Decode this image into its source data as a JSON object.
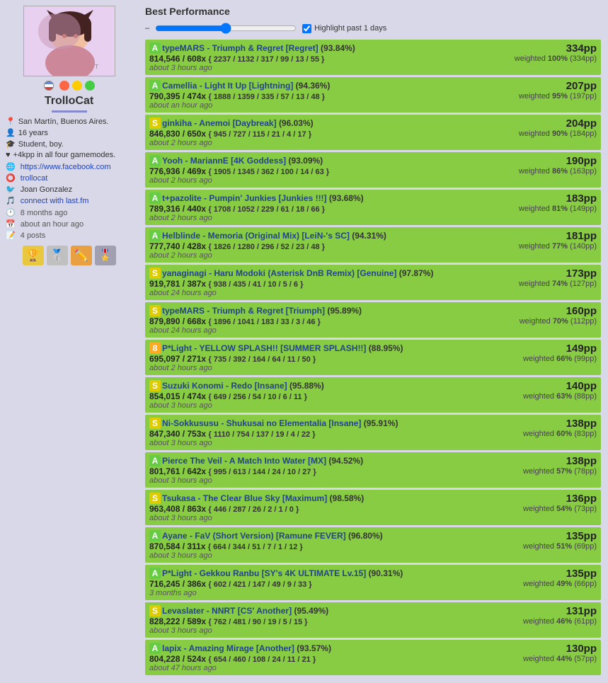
{
  "sidebar": {
    "username": "TrolloCat",
    "location": "San Martín, Buenos Aires.",
    "age": "16 years",
    "title": "Student, boy.",
    "tagline": "+4kpp in all four gamemodes.",
    "website": "https://www.facebook.com",
    "osu_name": "trollocat",
    "twitter": "Joan Gonzalez",
    "lastfm": "connect with last.fm",
    "last_online": "8 months ago",
    "member_since": "about an hour ago",
    "posts": "4 posts"
  },
  "main": {
    "title": "Best Performance",
    "highlight_label": "Highlight past 1 days",
    "performances": [
      {
        "rank": "A",
        "title": "typeMARS - Triumph & Regret [Regret]",
        "accuracy": "(93.84%)",
        "score": "814,546 / 608x",
        "hits": "{ 2237 / 1132 / 317 / 99 / 13 / 55 }",
        "time": "about 3 hours ago",
        "pp": "334pp",
        "weighted_pct": "100%",
        "weighted_pp": "334pp"
      },
      {
        "rank": "A",
        "title": "Camellia - Light It Up [Lightning]",
        "accuracy": "(94.36%)",
        "score": "790,395 / 474x",
        "hits": "{ 1888 / 1359 / 335 / 57 / 13 / 48 }",
        "time": "about an hour ago",
        "pp": "207pp",
        "weighted_pct": "95%",
        "weighted_pp": "197pp"
      },
      {
        "rank": "S",
        "title": "ginkiha - Anemoi [Daybreak]",
        "accuracy": "(96.03%)",
        "score": "846,830 / 650x",
        "hits": "{ 945 / 727 / 115 / 21 / 4 / 17 }",
        "time": "about 2 hours ago",
        "pp": "204pp",
        "weighted_pct": "90%",
        "weighted_pp": "184pp"
      },
      {
        "rank": "A",
        "title": "Yooh - MariannE [4K Goddess]",
        "accuracy": "(93.09%)",
        "score": "776,936 / 469x",
        "hits": "{ 1905 / 1345 / 362 / 100 / 14 / 63 }",
        "time": "about 2 hours ago",
        "pp": "190pp",
        "weighted_pct": "86%",
        "weighted_pp": "163pp"
      },
      {
        "rank": "A",
        "title": "t+pazolite - Pumpin' Junkies [Junkies !!!]",
        "accuracy": "(93.68%)",
        "score": "789,316 / 440x",
        "hits": "{ 1708 / 1052 / 229 / 61 / 18 / 66 }",
        "time": "about 2 hours ago",
        "pp": "183pp",
        "weighted_pct": "81%",
        "weighted_pp": "149pp"
      },
      {
        "rank": "A",
        "title": "Helblinde - Memoria (Original Mix) [LeiN-'s SC]",
        "accuracy": "(94.31%)",
        "score": "777,740 / 428x",
        "hits": "{ 1826 / 1280 / 296 / 52 / 23 / 48 }",
        "time": "about 2 hours ago",
        "pp": "181pp",
        "weighted_pct": "77%",
        "weighted_pp": "140pp"
      },
      {
        "rank": "S",
        "title": "yanaginagi - Haru Modoki (Asterisk DnB Remix) [Genuine]",
        "accuracy": "(97.87%)",
        "score": "919,781 / 387x",
        "hits": "{ 938 / 435 / 41 / 10 / 5 / 6 }",
        "time": "about 24 hours ago",
        "pp": "173pp",
        "weighted_pct": "74%",
        "weighted_pp": "127pp"
      },
      {
        "rank": "S",
        "title": "typeMARS - Triumph & Regret [Triumph]",
        "accuracy": "(95.89%)",
        "score": "879,890 / 668x",
        "hits": "{ 1896 / 1041 / 183 / 33 / 3 / 46 }",
        "time": "about 24 hours ago",
        "pp": "160pp",
        "weighted_pct": "70%",
        "weighted_pp": "112pp"
      },
      {
        "rank": "8",
        "title": "P*Light - YELLOW SPLASH!! [SUMMER SPLASH!!]",
        "accuracy": "(88.95%)",
        "score": "695,097 / 271x",
        "hits": "{ 735 / 392 / 164 / 64 / 11 / 50 }",
        "time": "about 2 hours ago",
        "pp": "149pp",
        "weighted_pct": "66%",
        "weighted_pp": "99pp"
      },
      {
        "rank": "S",
        "title": "Suzuki Konomi - Redo [Insane]",
        "accuracy": "(95.88%)",
        "score": "854,015 / 474x",
        "hits": "{ 649 / 256 / 54 / 10 / 6 / 11 }",
        "time": "about 3 hours ago",
        "pp": "140pp",
        "weighted_pct": "63%",
        "weighted_pp": "88pp"
      },
      {
        "rank": "S",
        "title": "Ni-Sokkususu - Shukusai no Elementalia [Insane]",
        "accuracy": "(95.91%)",
        "score": "847,340 / 753x",
        "hits": "{ 1110 / 754 / 137 / 19 / 4 / 22 }",
        "time": "about 3 hours ago",
        "pp": "138pp",
        "weighted_pct": "60%",
        "weighted_pp": "83pp"
      },
      {
        "rank": "A",
        "title": "Pierce The Veil - A Match Into Water [MX]",
        "accuracy": "(94.52%)",
        "score": "801,761 / 642x",
        "hits": "{ 995 / 613 / 144 / 24 / 10 / 27 }",
        "time": "about 3 hours ago",
        "pp": "138pp",
        "weighted_pct": "57%",
        "weighted_pp": "78pp"
      },
      {
        "rank": "S",
        "title": "Tsukasa - The Clear Blue Sky [Maximum]",
        "accuracy": "(98.58%)",
        "score": "963,408 / 863x",
        "hits": "{ 446 / 287 / 26 / 2 / 1 / 0 }",
        "time": "about 3 hours ago",
        "pp": "136pp",
        "weighted_pct": "54%",
        "weighted_pp": "73pp"
      },
      {
        "rank": "A",
        "title": "Ayane - FaV (Short Version) [Ramune FEVER]",
        "accuracy": "(96.80%)",
        "score": "870,584 / 311x",
        "hits": "{ 664 / 344 / 51 / 7 / 1 / 12 }",
        "time": "about 3 hours ago",
        "pp": "135pp",
        "weighted_pct": "51%",
        "weighted_pp": "69pp"
      },
      {
        "rank": "A",
        "title": "P*Light - Gekkou Ranbu [SY's 4K ULTIMATE Lv.15]",
        "accuracy": "(90.31%)",
        "score": "716,245 / 386x",
        "hits": "{ 602 / 421 / 147 / 49 / 9 / 33 }",
        "time": "3 months ago",
        "pp": "135pp",
        "weighted_pct": "49%",
        "weighted_pp": "66pp"
      },
      {
        "rank": "S",
        "title": "Levaslater - NNRT [CS' Another]",
        "accuracy": "(95.49%)",
        "score": "828,222 / 589x",
        "hits": "{ 762 / 481 / 90 / 19 / 5 / 15 }",
        "time": "about 3 hours ago",
        "pp": "131pp",
        "weighted_pct": "46%",
        "weighted_pp": "61pp"
      },
      {
        "rank": "A",
        "title": "lapix - Amazing Mirage [Another]",
        "accuracy": "(93.57%)",
        "score": "804,228 / 524x",
        "hits": "{ 654 / 460 / 108 / 24 / 11 / 21 }",
        "time": "about 47 hours ago",
        "pp": "130pp",
        "weighted_pct": "44%",
        "weighted_pp": "57pp"
      }
    ]
  }
}
